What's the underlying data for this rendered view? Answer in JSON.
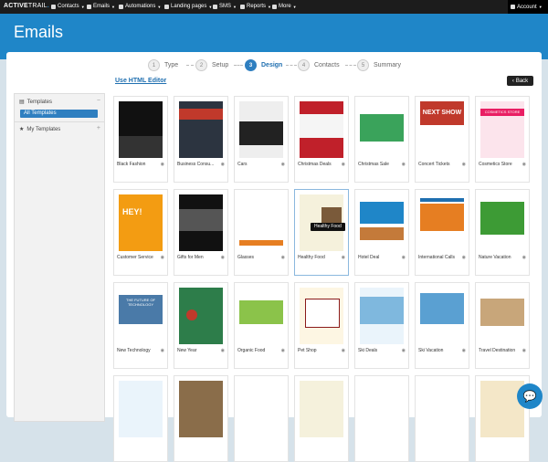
{
  "topbar": {
    "logo_main": "ACTIVE",
    "logo_sub": "TRAIL",
    "nav": [
      {
        "label": "Contacts"
      },
      {
        "label": "Emails"
      },
      {
        "label": "Automations"
      },
      {
        "label": "Landing pages"
      },
      {
        "label": "SMS"
      },
      {
        "label": "Reports"
      },
      {
        "label": "More"
      }
    ],
    "account": "Account"
  },
  "page": {
    "title": "Emails"
  },
  "wizard": {
    "steps": [
      {
        "num": "1",
        "label": "Type"
      },
      {
        "num": "2",
        "label": "Setup"
      },
      {
        "num": "3",
        "label": "Design"
      },
      {
        "num": "4",
        "label": "Contacts"
      },
      {
        "num": "5",
        "label": "Summary"
      }
    ],
    "active_step": "Design"
  },
  "links": {
    "html_editor": "Use HTML Editor",
    "back": "Back"
  },
  "sidebar": {
    "templates": "Templates",
    "all_templates": "All Templates",
    "my_templates": "My Templates"
  },
  "tooltip": "Healthy Food",
  "templates": [
    {
      "name": "Black Fashion"
    },
    {
      "name": "Business Consu..."
    },
    {
      "name": "Cars"
    },
    {
      "name": "Christmas Deals"
    },
    {
      "name": "Christmas Sale"
    },
    {
      "name": "Concert Tickets"
    },
    {
      "name": "Cosmetics Store"
    },
    {
      "name": "Customer Service"
    },
    {
      "name": "Gifts for Men"
    },
    {
      "name": "Glasses"
    },
    {
      "name": "Healthy Food"
    },
    {
      "name": "Hotel Deal"
    },
    {
      "name": "International Calls"
    },
    {
      "name": "Nature Vacation"
    },
    {
      "name": "New Technology"
    },
    {
      "name": "New Year"
    },
    {
      "name": "Organic Food"
    },
    {
      "name": "Pet Shop"
    },
    {
      "name": "Ski Deals"
    },
    {
      "name": "Ski Vacation"
    },
    {
      "name": "Travel Destination"
    }
  ],
  "thumb_text": {
    "next_show": "NEXT SHOW",
    "cosmetics": "COSMETICS STORE",
    "hey": "HEY!",
    "tech": "THE FUTURE OF TECHNOLOGY"
  },
  "colors": {
    "brand": "#1f86c8",
    "topbar": "#1c1c1c",
    "active_step": "#2f7fc0"
  }
}
